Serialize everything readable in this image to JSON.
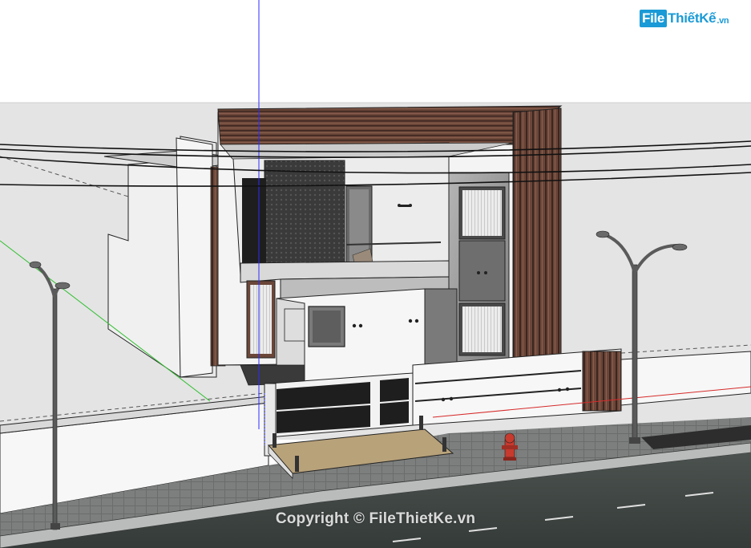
{
  "logo": {
    "brand_box": "File",
    "brand_text": "ThiếtKế",
    "brand_suffix": ".vn"
  },
  "watermark": {
    "text": "Copyright © FileThietKe.vn"
  },
  "colors": {
    "sky": "#ffffff",
    "ground": "#e4e4e4",
    "wood": "#5a3a2e",
    "concrete": "#9a9a9a",
    "wall": "#f2f2f2",
    "road": "#3e4542",
    "axis_blue": "#2b2bff",
    "axis_green": "#2fbf2f",
    "axis_red": "#d62a2a",
    "hydrant": "#c73a2e"
  }
}
